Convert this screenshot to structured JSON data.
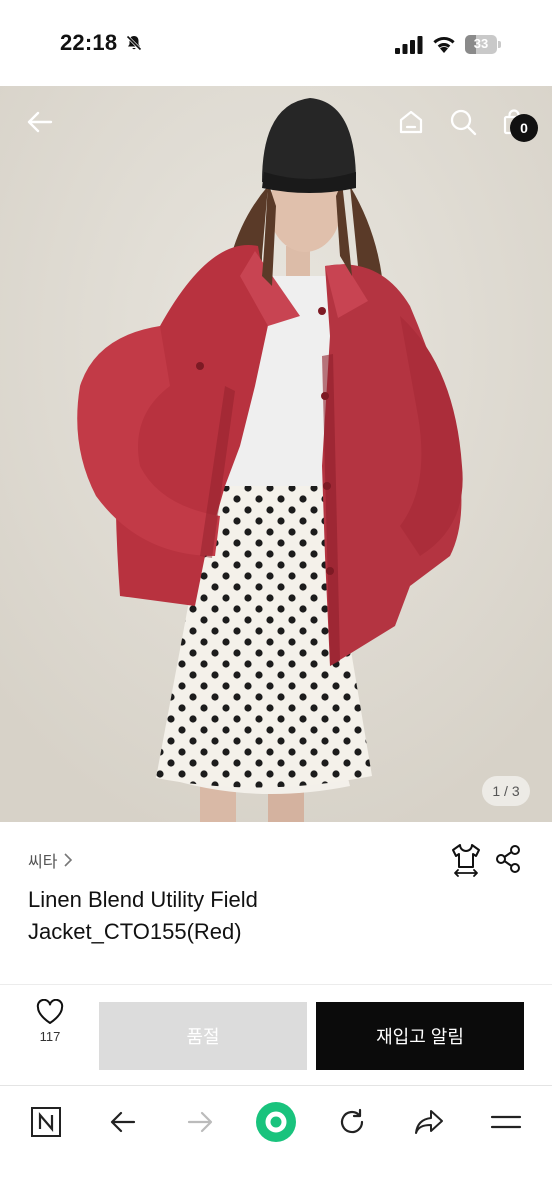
{
  "status_bar": {
    "time": "22:18",
    "battery_level": "33"
  },
  "hero": {
    "page_counter": "1 / 3",
    "cart_count": "0"
  },
  "product": {
    "brand": "씨타",
    "title": "Linen Blend Utility Field Jacket_CTO155(Red)"
  },
  "actions": {
    "like_count": "117",
    "soldout_label": "품절",
    "restock_label": "재입고 알림"
  },
  "colors": {
    "accent_green": "#19c37d",
    "jacket_red": "#b83540",
    "button_dark": "#0b0b0b",
    "button_disabled": "#dcdcdc"
  },
  "browser_bar": {
    "icons": [
      "naver-n-icon",
      "back-arrow-icon",
      "forward-arrow-icon",
      "green-home-icon",
      "refresh-icon",
      "share-arrow-icon",
      "menu-icon"
    ]
  }
}
